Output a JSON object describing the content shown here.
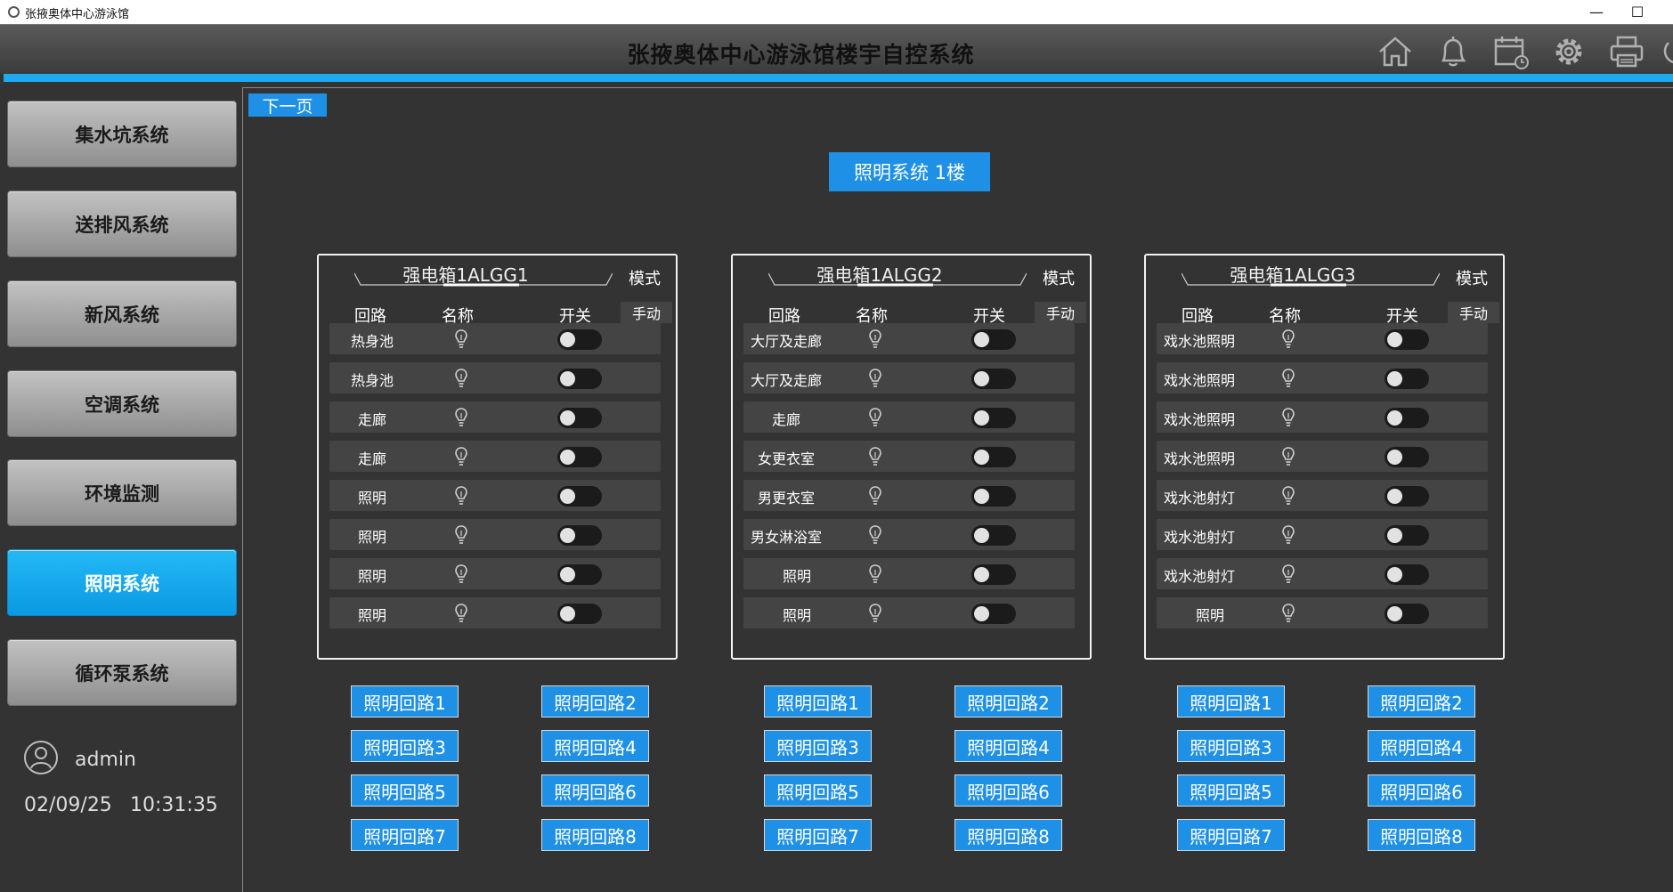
{
  "window": {
    "title": "张掖奥体中心游泳馆",
    "min": "—",
    "max": "☐"
  },
  "header": {
    "title": "张掖奥体中心游泳馆楼宇自控系统",
    "icons": [
      "home-icon",
      "bell-icon",
      "calendar-icon",
      "gear-icon",
      "printer-icon",
      "power-icon"
    ]
  },
  "sidebar": {
    "items": [
      {
        "label": "集水坑系统"
      },
      {
        "label": "送排风系统"
      },
      {
        "label": "新风系统"
      },
      {
        "label": "空调系统"
      },
      {
        "label": "环境监测"
      },
      {
        "label": "照明系统",
        "active": true
      },
      {
        "label": "循环泵系统"
      }
    ],
    "user": "admin",
    "date": "02/09/25",
    "time": "10:31:35"
  },
  "main": {
    "next_label": "下一页",
    "section_title": "照明系统  1楼",
    "headers": {
      "circuit": "回路",
      "name": "名称",
      "switch": "开关",
      "mode": "模式",
      "manual": "手动"
    },
    "panels": [
      {
        "name": "强电箱1ALGG1",
        "rows": [
          {
            "name": "热身池",
            "on": false
          },
          {
            "name": "热身池",
            "on": false
          },
          {
            "name": "走廊",
            "on": false
          },
          {
            "name": "走廊",
            "on": false
          },
          {
            "name": "照明",
            "on": false
          },
          {
            "name": "照明",
            "on": false
          },
          {
            "name": "照明",
            "on": false
          },
          {
            "name": "照明",
            "on": false
          }
        ]
      },
      {
        "name": "强电箱1ALGG2",
        "rows": [
          {
            "name": "大厅及走廊",
            "on": false
          },
          {
            "name": "大厅及走廊",
            "on": false
          },
          {
            "name": "走廊",
            "on": false
          },
          {
            "name": "女更衣室",
            "on": false
          },
          {
            "name": "男更衣室",
            "on": false
          },
          {
            "name": "男女淋浴室",
            "on": false
          },
          {
            "name": "照明",
            "on": false
          },
          {
            "name": "照明",
            "on": false
          }
        ]
      },
      {
        "name": "强电箱1ALGG3",
        "rows": [
          {
            "name": "戏水池照明",
            "on": false
          },
          {
            "name": "戏水池照明",
            "on": false
          },
          {
            "name": "戏水池照明",
            "on": false
          },
          {
            "name": "戏水池照明",
            "on": false
          },
          {
            "name": "戏水池射灯",
            "on": false
          },
          {
            "name": "戏水池射灯",
            "on": false
          },
          {
            "name": "戏水池射灯",
            "on": false
          },
          {
            "name": "照明",
            "on": false
          }
        ]
      }
    ],
    "circuit_buttons": [
      "照明回路1",
      "照明回路2",
      "照明回路3",
      "照明回路4",
      "照明回路5",
      "照明回路6",
      "照明回路7",
      "照明回路8"
    ]
  },
  "colors": {
    "accent": "#1e90e6",
    "strip": "#1eaaf1",
    "background": "#333333"
  }
}
